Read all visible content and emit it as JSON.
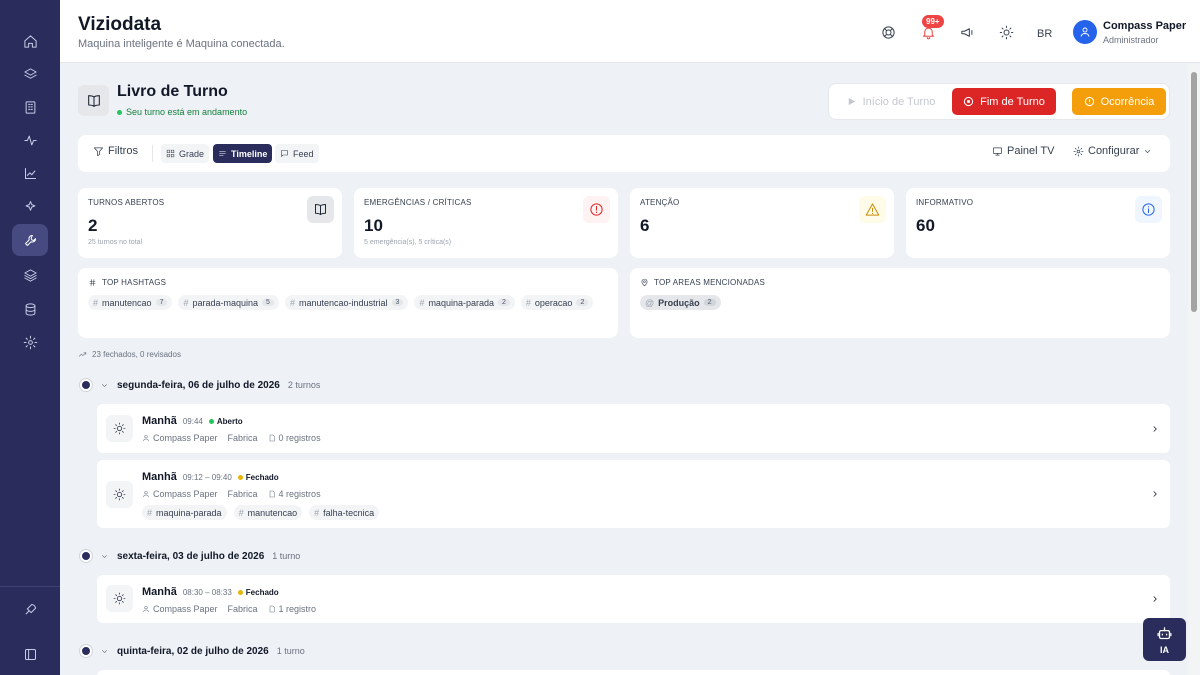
{
  "app": {
    "title": "Viziodata",
    "subtitle": "Maquina inteligente é Maquina conectada."
  },
  "header": {
    "notif_badge": "99+",
    "language": "BR",
    "user_name": "Compass Paper",
    "user_role": "Administrador"
  },
  "page": {
    "title": "Livro de Turno",
    "status": "Seu turno está em andamento"
  },
  "actions": {
    "start": "Início de Turno",
    "end": "Fim de Turno",
    "occurrence": "Ocorrência"
  },
  "toolbar": {
    "filters": "Filtros",
    "view_grid": "Grade",
    "view_timeline": "Timeline",
    "view_feed": "Feed",
    "tv_panel": "Painel TV",
    "configure": "Configurar"
  },
  "stats": [
    {
      "label": "TURNOS ABERTOS",
      "value": "2",
      "sub": "25 turnos no total",
      "icon": "book-icon"
    },
    {
      "label": "EMERGÊNCIAS / CRÍTICAS",
      "value": "10",
      "sub": "5 emergência(s), 5 crítica(s)",
      "icon": "alert-circle-icon"
    },
    {
      "label": "ATENÇÃO",
      "value": "6",
      "sub": "",
      "icon": "warning-icon"
    },
    {
      "label": "INFORMATIVO",
      "value": "60",
      "sub": "",
      "icon": "info-icon"
    }
  ],
  "top_hashtags": {
    "title": "TOP HASHTAGS",
    "items": [
      {
        "tag": "manutencao",
        "count": "7"
      },
      {
        "tag": "parada-maquina",
        "count": "5"
      },
      {
        "tag": "manutencao-industrial",
        "count": "3"
      },
      {
        "tag": "maquina-parada",
        "count": "2"
      },
      {
        "tag": "operacao",
        "count": "2"
      }
    ]
  },
  "top_areas": {
    "title": "TOP AREAS MENCIONADAS",
    "items": [
      {
        "area": "Produção",
        "count": "2"
      }
    ]
  },
  "closed_note": "23 fechados, 0 revisados",
  "days": [
    {
      "title": "segunda-feira, 06 de julho de 2026",
      "count": "2 turnos"
    },
    {
      "title": "sexta-feira, 03 de julho de 2026",
      "count": "1 turno"
    },
    {
      "title": "quinta-feira, 02 de julho de 2026",
      "count": "1 turno"
    }
  ],
  "shifts": [
    {
      "name": "Manhã",
      "time": "09:44",
      "status": "Aberto",
      "status_color": "#22c55e",
      "user": "Compass Paper",
      "area": "Fabrica",
      "records": "0 registros",
      "tags": []
    },
    {
      "name": "Manhã",
      "time": "09:12 – 09:40",
      "status": "Fechado",
      "status_color": "#eab308",
      "user": "Compass Paper",
      "area": "Fabrica",
      "records": "4 registros",
      "tags": [
        "maquina-parada",
        "manutencao",
        "falha-tecnica"
      ]
    },
    {
      "name": "Manhã",
      "time": "08:30 – 08:33",
      "status": "Fechado",
      "status_color": "#eab308",
      "user": "Compass Paper",
      "area": "Fabrica",
      "records": "1 registro",
      "tags": []
    }
  ],
  "ia_label": "IA",
  "colors": {
    "brand": "#2a2d5c",
    "danger": "#dc2626",
    "warning": "#f59e0b",
    "open": "#22c55e",
    "closed": "#eab308"
  }
}
